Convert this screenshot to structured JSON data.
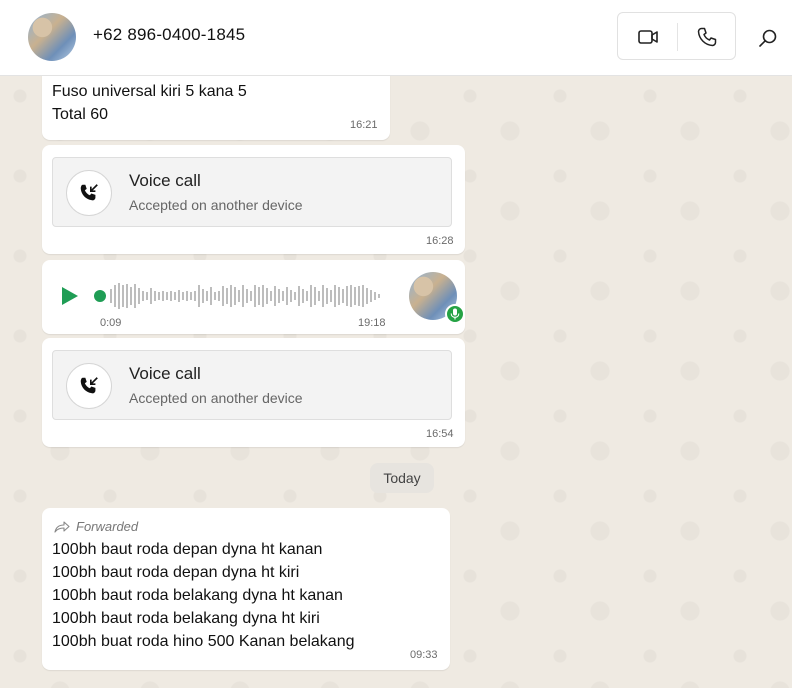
{
  "header": {
    "contact_name": "+62 896-0400-1845",
    "icons": {
      "video": "video-camera-icon",
      "phone": "phone-icon",
      "search": "search-icon"
    }
  },
  "messages": {
    "m1": {
      "lines": [
        "Fuso universal kiri 5 kana 5",
        "Total 60"
      ],
      "time": "16:21"
    },
    "call1": {
      "title": "Voice call",
      "subtitle": "Accepted on another device",
      "time": "16:28"
    },
    "voice": {
      "duration": "0:09",
      "time": "19:18"
    },
    "call2": {
      "title": "Voice call",
      "subtitle": "Accepted on another device",
      "time": "16:54"
    },
    "date_chip": "Today",
    "m2": {
      "forwarded_label": "Forwarded",
      "lines": [
        "100bh baut roda depan dyna ht kanan",
        "100bh baut roda depan dyna ht kiri",
        "100bh baut roda belakang dyna ht kanan",
        "100bh baut roda belakang dyna ht kiri",
        "100bh buat roda hino 500 Kanan belakang"
      ],
      "time": "09:33"
    }
  },
  "colors": {
    "accent_green": "#25a244",
    "chat_bg": "#efeae2",
    "bubble": "#ffffff"
  }
}
